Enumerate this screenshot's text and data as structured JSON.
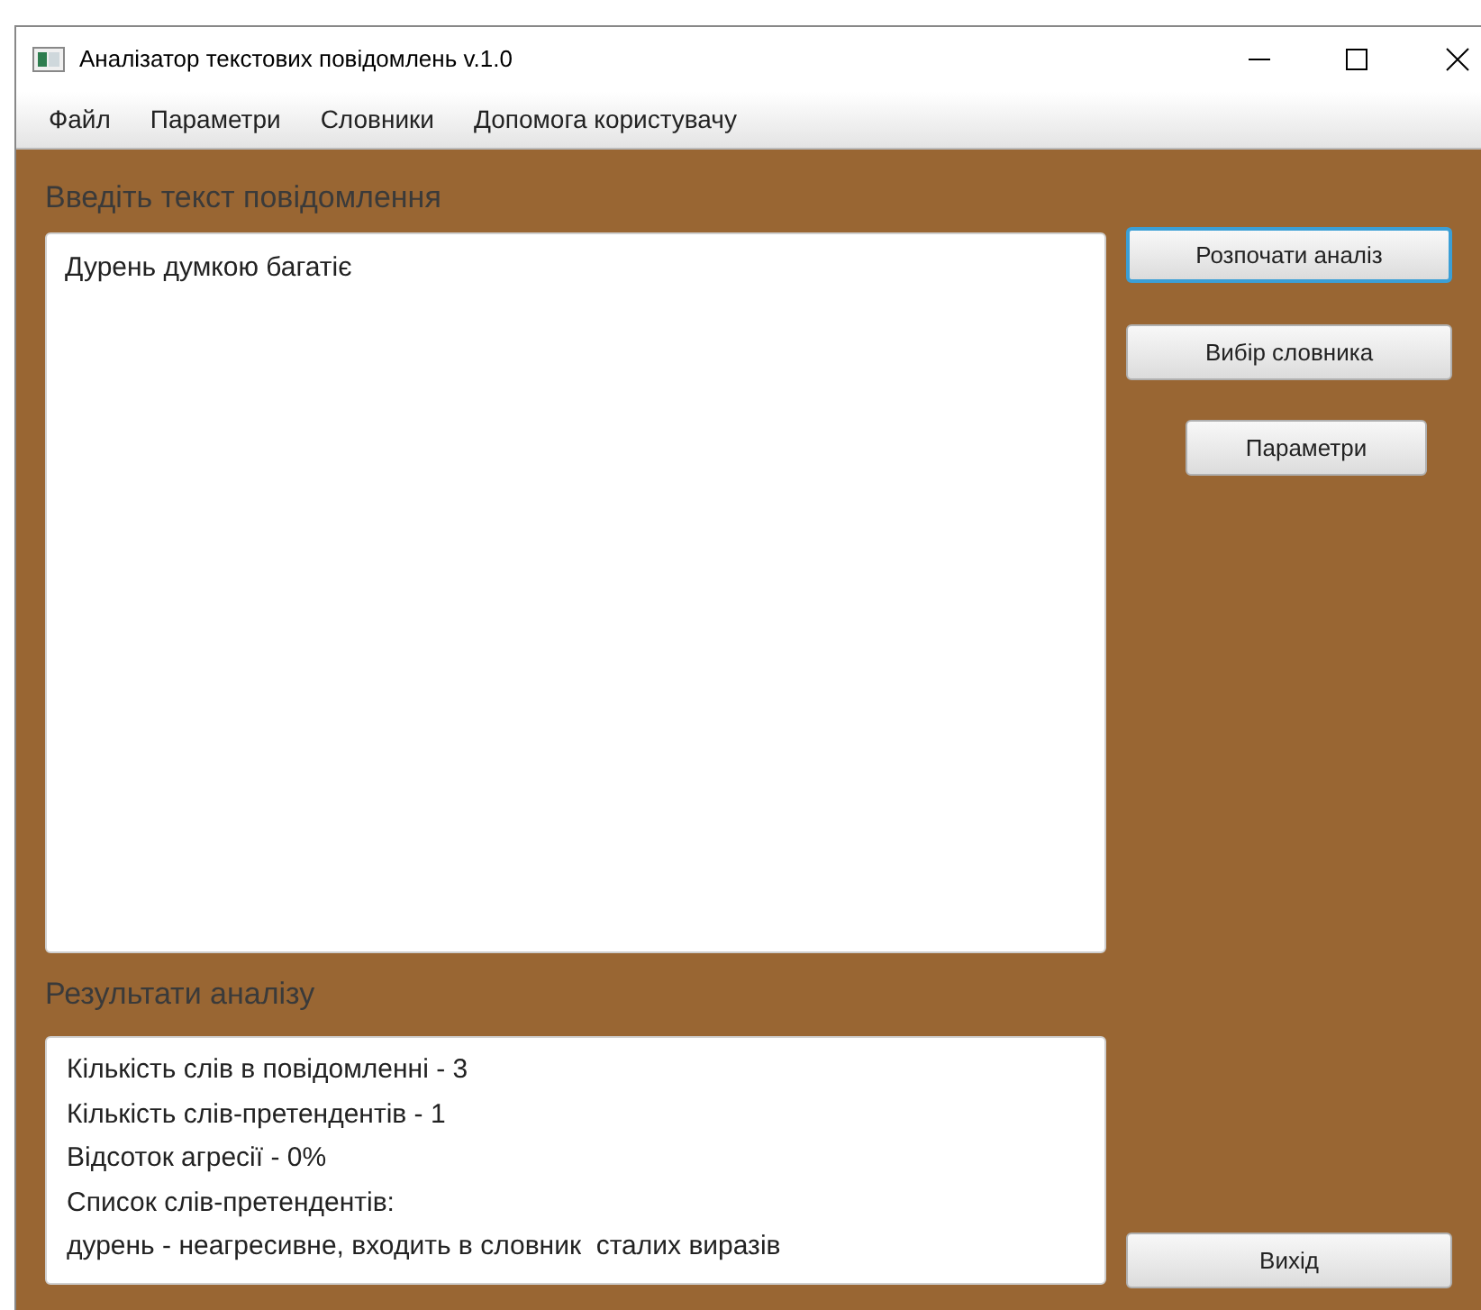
{
  "window": {
    "title": "Аналізатор текстових повідомлень v.1.0"
  },
  "menu": [
    "Файл",
    "Параметри",
    "Словники",
    "Допомога користувачу"
  ],
  "input": {
    "label": "Введіть текст повідомлення",
    "value": "Дурень думкою багатіє"
  },
  "results": {
    "label": "Результати аналізу",
    "lines": [
      "Кількість слів в повідомленні - 3",
      "Кількість слів-претендентів - 1",
      "Відсоток агресії - 0%",
      "Список слів-претендентів:",
      "дурень - неагресивне, входить в словник  сталих виразів"
    ]
  },
  "buttons": [
    {
      "label": "Розпочати аналіз",
      "focused": true
    },
    {
      "label": "Вибір словника",
      "focused": false
    },
    {
      "label": "Параметри",
      "focused": false
    }
  ],
  "exit_button": {
    "label": "Вихід"
  }
}
